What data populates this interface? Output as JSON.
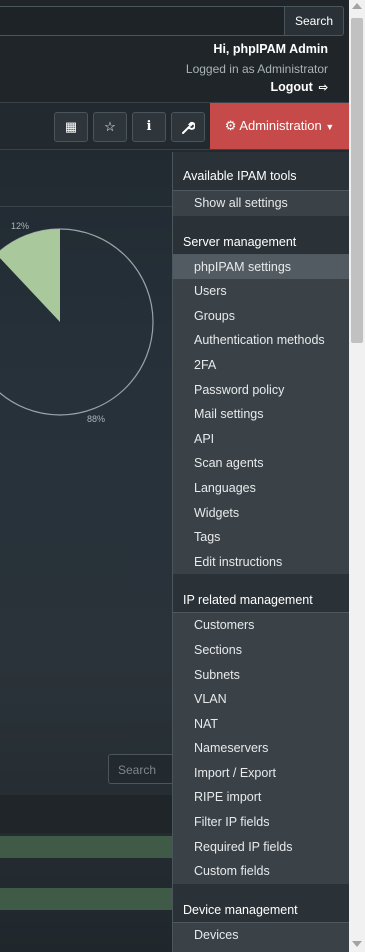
{
  "header": {
    "search_button": "Search",
    "greeting": "Hi, phpIPAM Admin",
    "logged_in_as": "Logged in as  Administrator",
    "logout": "Logout"
  },
  "toolbar": {
    "buttons": [
      {
        "icon": "dashboard-grid-icon",
        "glyph": "▦"
      },
      {
        "icon": "star-icon",
        "glyph": "☆"
      },
      {
        "icon": "info-icon",
        "glyph": "i"
      },
      {
        "icon": "wrench-icon",
        "glyph": "🔧"
      }
    ],
    "admin_label": "Administration"
  },
  "chart_data": {
    "type": "pie",
    "slices": [
      {
        "label": "12%",
        "value": 12,
        "color": "#a9c99d"
      },
      {
        "label": "88%",
        "value": 88,
        "color": "transparent"
      }
    ]
  },
  "content": {
    "search_placeholder": "Search"
  },
  "dropdown": {
    "sections": [
      {
        "title": "Available IPAM tools",
        "items": [
          "Show all settings"
        ]
      },
      {
        "title": "Server management",
        "items": [
          "phpIPAM settings",
          "Users",
          "Groups",
          "Authentication methods",
          "2FA",
          "Password policy",
          "Mail settings",
          "API",
          "Scan agents",
          "Languages",
          "Widgets",
          "Tags",
          "Edit instructions"
        ],
        "active": "phpIPAM settings"
      },
      {
        "title": "IP related management",
        "items": [
          "Customers",
          "Sections",
          "Subnets",
          "VLAN",
          "NAT",
          "Nameservers",
          "Import / Export",
          "RIPE import",
          "Filter IP fields",
          "Required IP fields",
          "Custom fields"
        ]
      },
      {
        "title": "Device management",
        "items": [
          "Devices"
        ]
      }
    ]
  },
  "colors": {
    "admin_accent": "#c74a4a",
    "pie_slice": "#a9c99d",
    "table_band": "#3f5b48"
  }
}
